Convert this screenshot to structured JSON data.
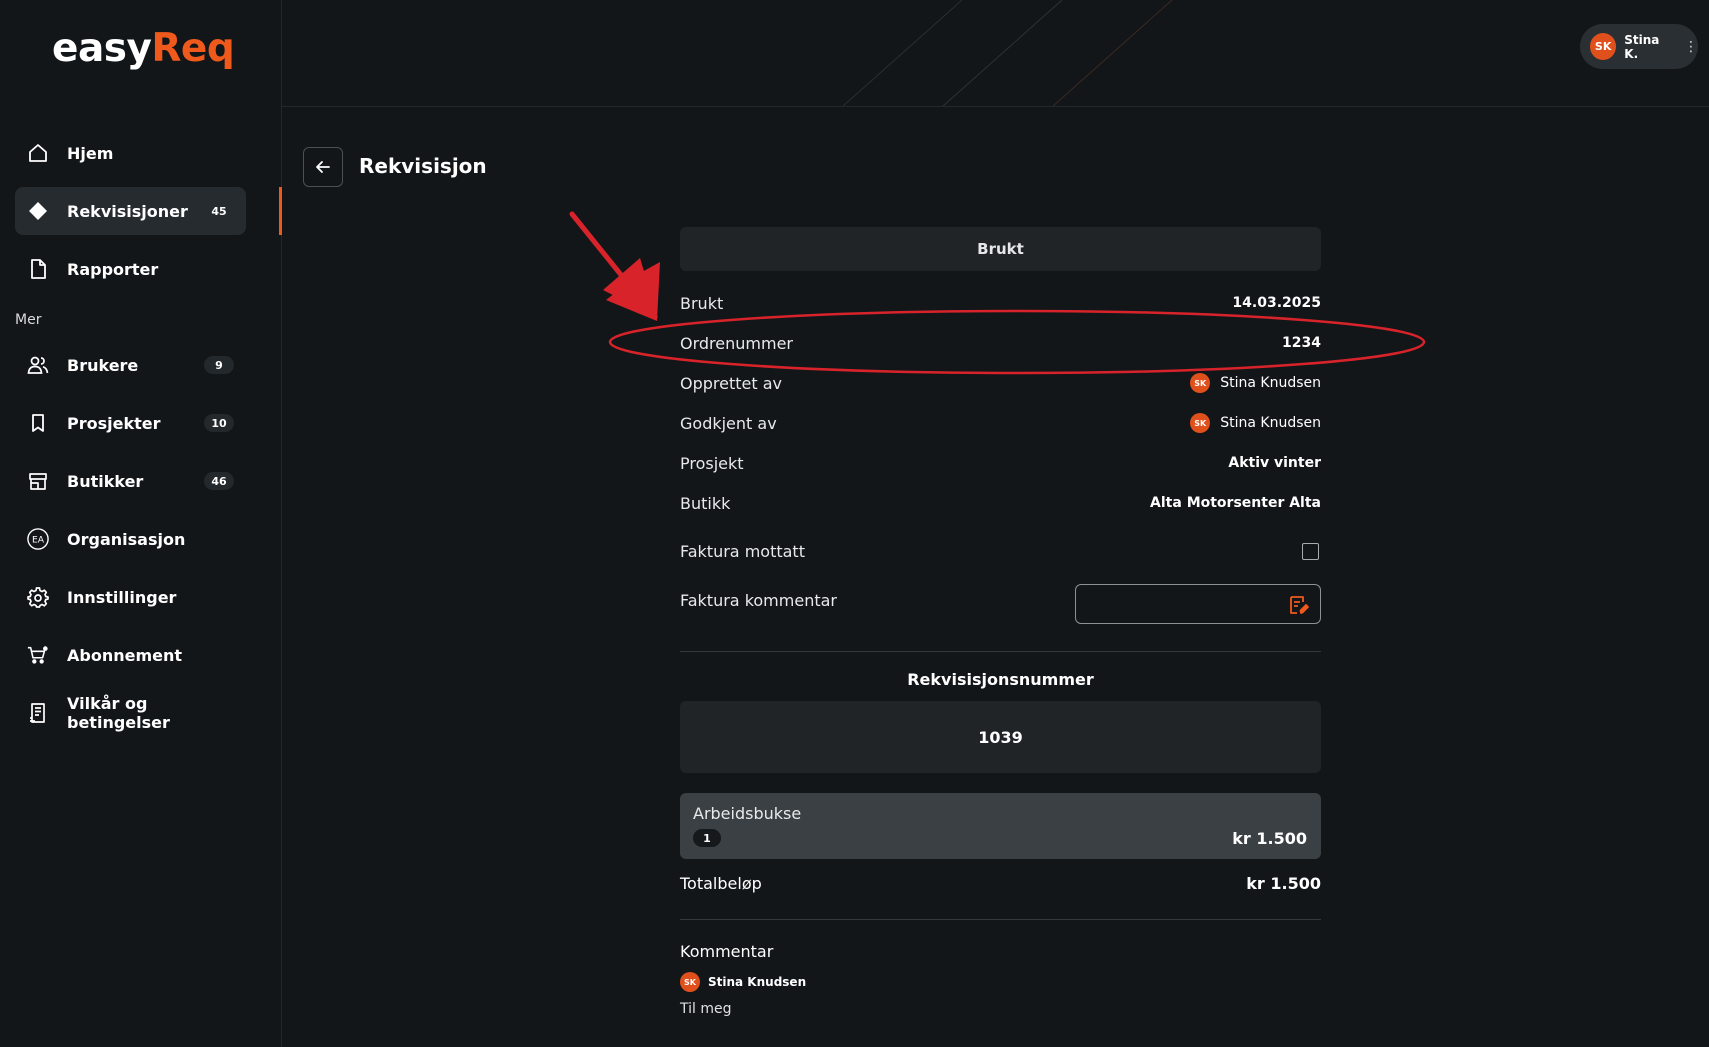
{
  "app": {
    "logo_part1": "easy",
    "logo_part2": "Req",
    "brand_color": "#ef5a1c"
  },
  "user": {
    "initials": "SK",
    "name": "Stina K.",
    "menu_icon": "more-vertical-icon"
  },
  "sidebar": {
    "items": [
      {
        "label": "Hjem",
        "icon": "home-icon"
      },
      {
        "label": "Rekvisisjoner",
        "icon": "diamond-icon",
        "badge": "45",
        "active": true
      },
      {
        "label": "Rapporter",
        "icon": "document-icon"
      }
    ],
    "section_label": "Mer",
    "more_items": [
      {
        "label": "Brukere",
        "icon": "users-icon",
        "badge": "9"
      },
      {
        "label": "Prosjekter",
        "icon": "bookmark-icon",
        "badge": "10"
      },
      {
        "label": "Butikker",
        "icon": "store-icon",
        "badge": "46"
      },
      {
        "label": "Organisasjon",
        "icon": "organization-icon",
        "icon_text": "EA"
      },
      {
        "label": "Innstillinger",
        "icon": "gear-icon"
      },
      {
        "label": "Abonnement",
        "icon": "cart-icon"
      },
      {
        "label": "Vilkår og betingelser",
        "icon": "terms-icon"
      }
    ]
  },
  "page": {
    "title": "Rekvisisjon"
  },
  "status": {
    "label": "Brukt"
  },
  "details": {
    "used_label": "Brukt",
    "used_value": "14.03.2025",
    "order_label": "Ordrenummer",
    "order_value": "1234",
    "created_label": "Opprettet av",
    "created_initials": "SK",
    "created_value": "Stina Knudsen",
    "approved_label": "Godkjent av",
    "approved_initials": "SK",
    "approved_value": "Stina Knudsen",
    "project_label": "Prosjekt",
    "project_value": "Aktiv vinter",
    "store_label": "Butikk",
    "store_value": "Alta Motorsenter Alta",
    "invoice_received_label": "Faktura mottatt",
    "invoice_comment_label": "Faktura kommentar",
    "invoice_comment_value": ""
  },
  "requisition": {
    "number_label": "Rekvisisjonsnummer",
    "number_value": "1039",
    "items": [
      {
        "name": "Arbeidsbukse",
        "qty": "1",
        "price": "kr 1.500"
      }
    ],
    "total_label": "Totalbeløp",
    "total_value": "kr 1.500"
  },
  "comment": {
    "title": "Kommentar",
    "author_initials": "SK",
    "author": "Stina Knudsen",
    "text": "Til meg"
  },
  "colors": {
    "background": "#121619",
    "accent": "#ef5a1c",
    "annotation": "#d9232a"
  }
}
